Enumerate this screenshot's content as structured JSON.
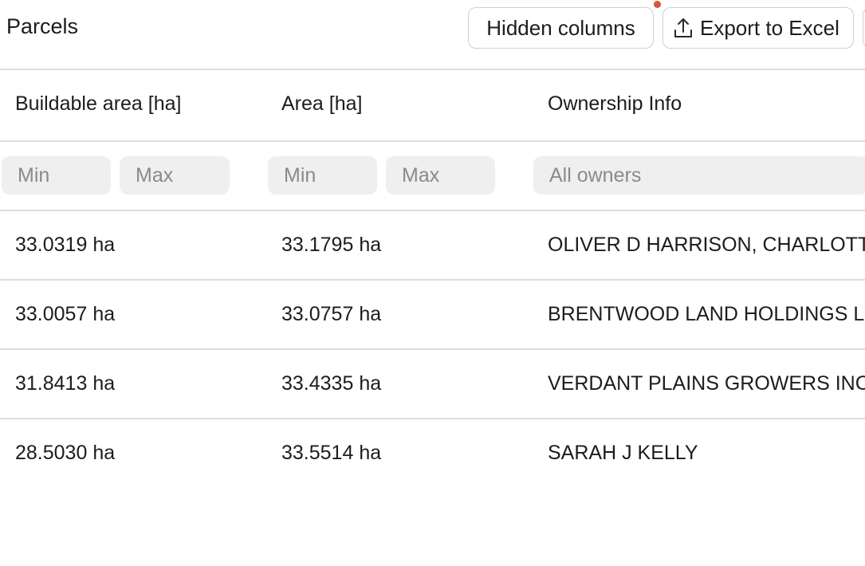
{
  "header": {
    "title": "Parcels",
    "hidden_columns_label": "Hidden columns",
    "export_label": "Export to Excel"
  },
  "columns": [
    "Buildable area [ha]",
    "Area [ha]",
    "Ownership Info"
  ],
  "filters": {
    "buildable_min_placeholder": "Min",
    "buildable_max_placeholder": "Max",
    "area_min_placeholder": "Min",
    "area_max_placeholder": "Max",
    "owner_placeholder": "All owners"
  },
  "rows": [
    {
      "buildable_area": "33.0319 ha",
      "area": "33.1795 ha",
      "owner": "OLIVER D HARRISON, CHARLOTTE"
    },
    {
      "buildable_area": "33.0057 ha",
      "area": "33.0757 ha",
      "owner": "BRENTWOOD LAND HOLDINGS LLC"
    },
    {
      "buildable_area": "31.8413 ha",
      "area": "33.4335 ha",
      "owner": "VERDANT PLAINS GROWERS INC"
    },
    {
      "buildable_area": "28.5030 ha",
      "area": "33.5514 ha",
      "owner": "SARAH J KELLY"
    }
  ],
  "icons": {
    "export": "upload-icon",
    "notification": "notification-dot"
  },
  "colors": {
    "notification_dot": "#d9553a",
    "filter_bg": "#efefef",
    "divider": "#dcdcdc"
  }
}
